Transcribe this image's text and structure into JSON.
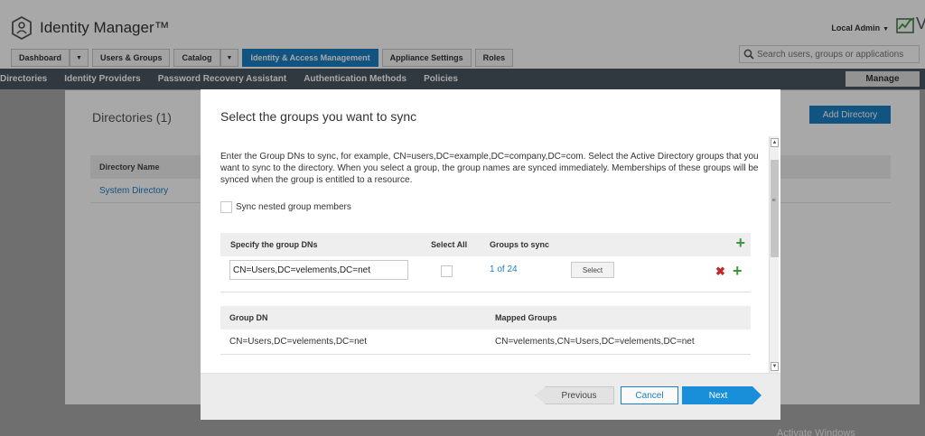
{
  "header": {
    "app_name": "Identity Manager™",
    "user_menu": "Local Admin",
    "cut_off_text": "V",
    "search": {
      "placeholder": "Search users, groups or applications"
    }
  },
  "tabs": [
    {
      "label": "Dashboard",
      "has_caret": true
    },
    {
      "label": "Users & Groups"
    },
    {
      "label": "Catalog",
      "has_caret": true
    },
    {
      "label": "Identity & Access Management",
      "active": true
    },
    {
      "label": "Appliance Settings"
    },
    {
      "label": "Roles"
    }
  ],
  "subnav": {
    "items": [
      "Directories",
      "Identity Providers",
      "Password Recovery Assistant",
      "Authentication Methods",
      "Policies"
    ],
    "manage_label": "Manage"
  },
  "directories_page": {
    "title": "Directories (1)",
    "add_button": "Add Directory",
    "column_header": "Directory Name",
    "rows": [
      "System Directory"
    ]
  },
  "modal": {
    "title": "Select the groups you want to sync",
    "description": "Enter the Group DNs to sync, for example, CN=users,DC=example,DC=company,DC=com. Select the Active Directory groups that you want to sync to the directory. When you select a group, the group names are synced immediately. Memberships of these groups will be synced when the group is entitled to a resource.",
    "nested_checkbox_label": "Sync nested group members",
    "dn_table": {
      "headers": [
        "Specify the group DNs",
        "Select All",
        "Groups to sync"
      ],
      "row": {
        "dn_value": "CN=Users,DC=velements,DC=net",
        "count": "1 of 24",
        "select_label": "Select"
      }
    },
    "mapping_table": {
      "headers": [
        "Group DN",
        "Mapped Groups"
      ],
      "rows": [
        {
          "group_dn": "CN=Users,DC=velements,DC=net",
          "mapped": "CN=velements,CN=Users,DC=velements,DC=net"
        }
      ]
    },
    "buttons": {
      "previous": "Previous",
      "cancel": "Cancel",
      "next": "Next"
    }
  },
  "watermark": "Activate Windows",
  "colors": {
    "accent": "#1a7fc4",
    "subnav": "#4a5760",
    "add": "#3a9a3a",
    "remove": "#c0282e"
  }
}
